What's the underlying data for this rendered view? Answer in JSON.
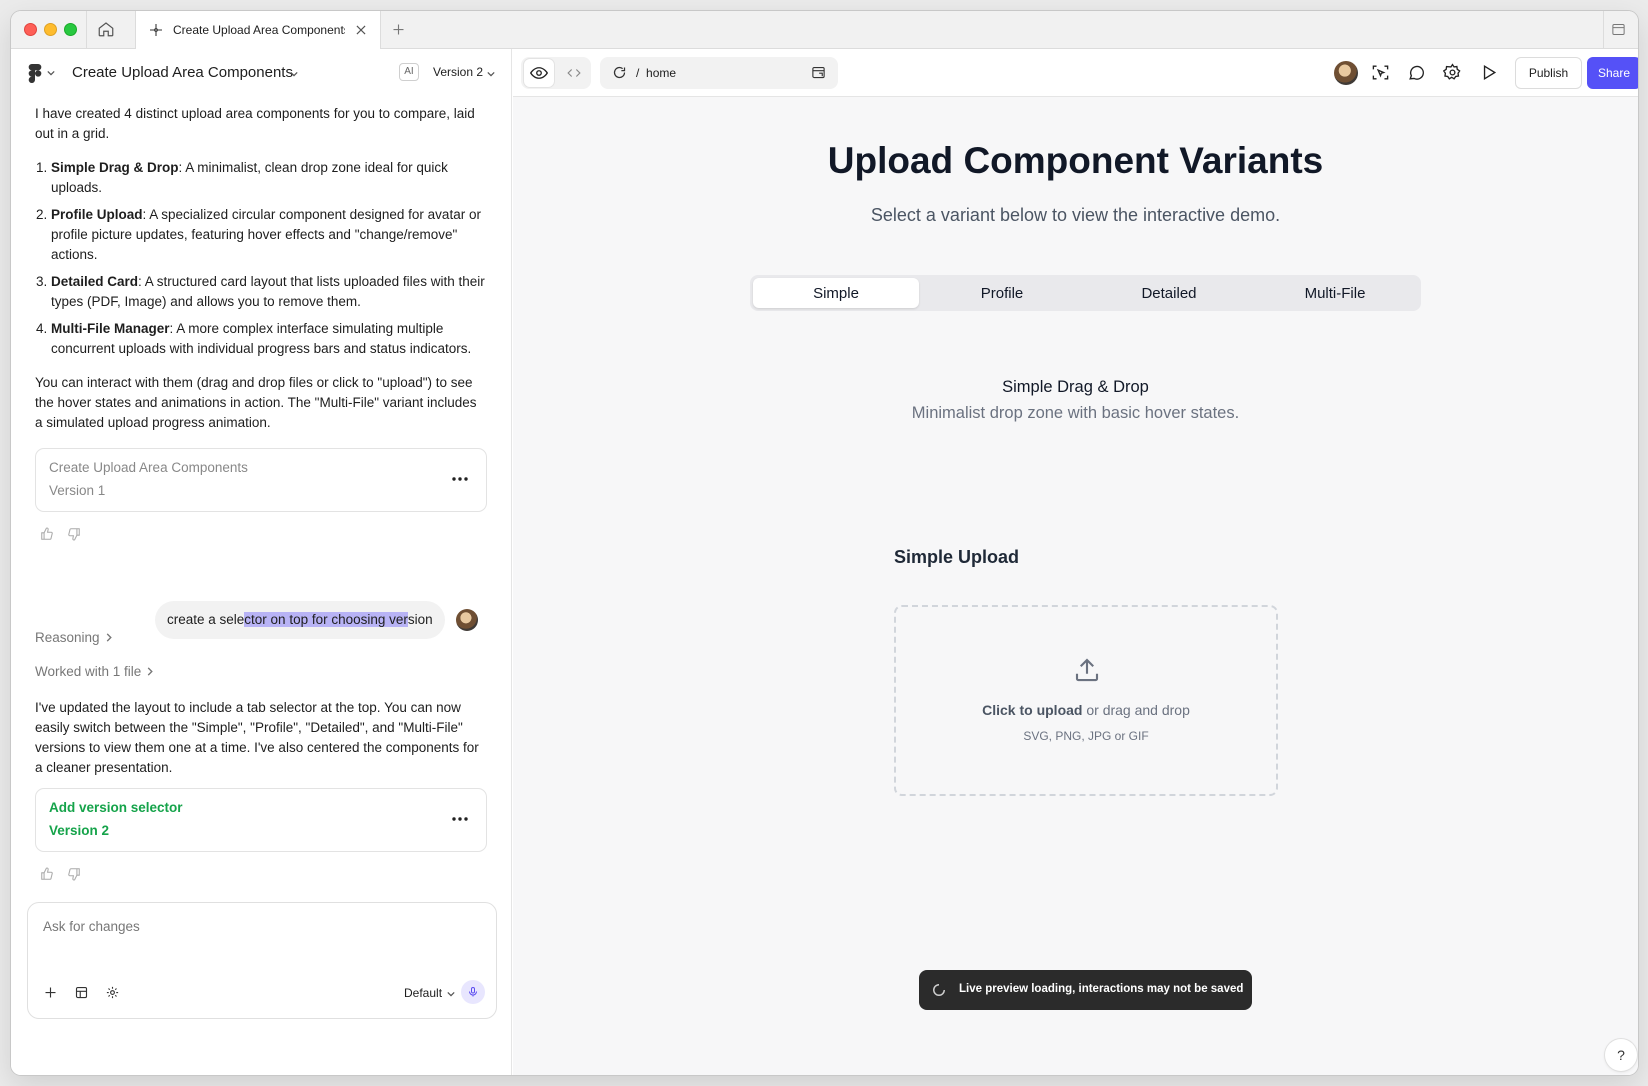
{
  "browser": {
    "tab_title": "Create Upload Area Components"
  },
  "left_panel": {
    "project_title": "Create Upload Area Components",
    "ai_badge": "AI",
    "version_selector": "Version 2",
    "message_intro": "I have created 4 distinct upload area components for you to compare, laid out in a grid.",
    "list": [
      {
        "title": "Simple Drag & Drop",
        "text": ": A minimalist, clean drop zone ideal for quick uploads."
      },
      {
        "title": "Profile Upload",
        "text": ": A specialized circular component designed for avatar or profile picture updates, featuring hover effects and \"change/remove\" actions."
      },
      {
        "title": "Detailed Card",
        "text": ": A structured card layout that lists uploaded files with their types (PDF, Image) and allows you to remove them."
      },
      {
        "title": "Multi-File Manager",
        "text": ": A more complex interface simulating multiple concurrent uploads with individual progress bars and status indicators."
      }
    ],
    "message_outro": "You can interact with them (drag and drop files or click to \"upload\") to see the hover states and animations in action. The \"Multi-File\" variant includes a simulated upload progress animation.",
    "card1": {
      "title": "Create Upload Area Components",
      "version": "Version 1"
    },
    "user_message": {
      "before": "create a sele",
      "highlight": "ctor on top for choosing ver",
      "after": "sion"
    },
    "reasoning_label": "Reasoning",
    "worked_label": "Worked with 1 file",
    "message2": "I've updated the layout to include a tab selector at the top. You can now easily switch between the \"Simple\", \"Profile\", \"Detailed\", and \"Multi-File\" versions to view them one at a time. I've also centered the components for a cleaner presentation.",
    "card2": {
      "title": "Add version selector",
      "version": "Version 2"
    },
    "composer": {
      "placeholder": "Ask for changes",
      "model": "Default"
    }
  },
  "toolbar": {
    "url": "home",
    "publish_label": "Publish",
    "share_label": "Share"
  },
  "preview": {
    "title": "Upload Component Variants",
    "subtitle": "Select a variant below to view the interactive demo.",
    "tabs": [
      "Simple",
      "Profile",
      "Detailed",
      "Multi-File"
    ],
    "active_tab": "Simple",
    "variant_title": "Simple Drag & Drop",
    "variant_desc": "Minimalist drop zone with basic hover states.",
    "section_title": "Simple Upload",
    "dropzone": {
      "click_label": "Click to upload",
      "rest": " or drag and drop",
      "hint": "SVG, PNG, JPG or GIF"
    },
    "toast": "Live preview loading, interactions may not be saved",
    "help": "?"
  },
  "colors": {
    "accent": "#5551f7",
    "success": "#15a34a",
    "highlight": "#b8b3f5"
  },
  "icons": [
    "home-icon",
    "figma-icon",
    "close-icon",
    "plus-icon",
    "sidebar-icon",
    "chevron-down-icon",
    "more-icon",
    "thumbs-up-icon",
    "thumbs-down-icon",
    "chevron-right-icon",
    "attach-icon",
    "sparkle-icon",
    "mic-icon",
    "eye-icon",
    "code-icon",
    "reload-icon",
    "external-icon",
    "inspect-icon",
    "comment-icon",
    "settings-icon",
    "play-icon",
    "upload-icon",
    "spinner-icon"
  ]
}
